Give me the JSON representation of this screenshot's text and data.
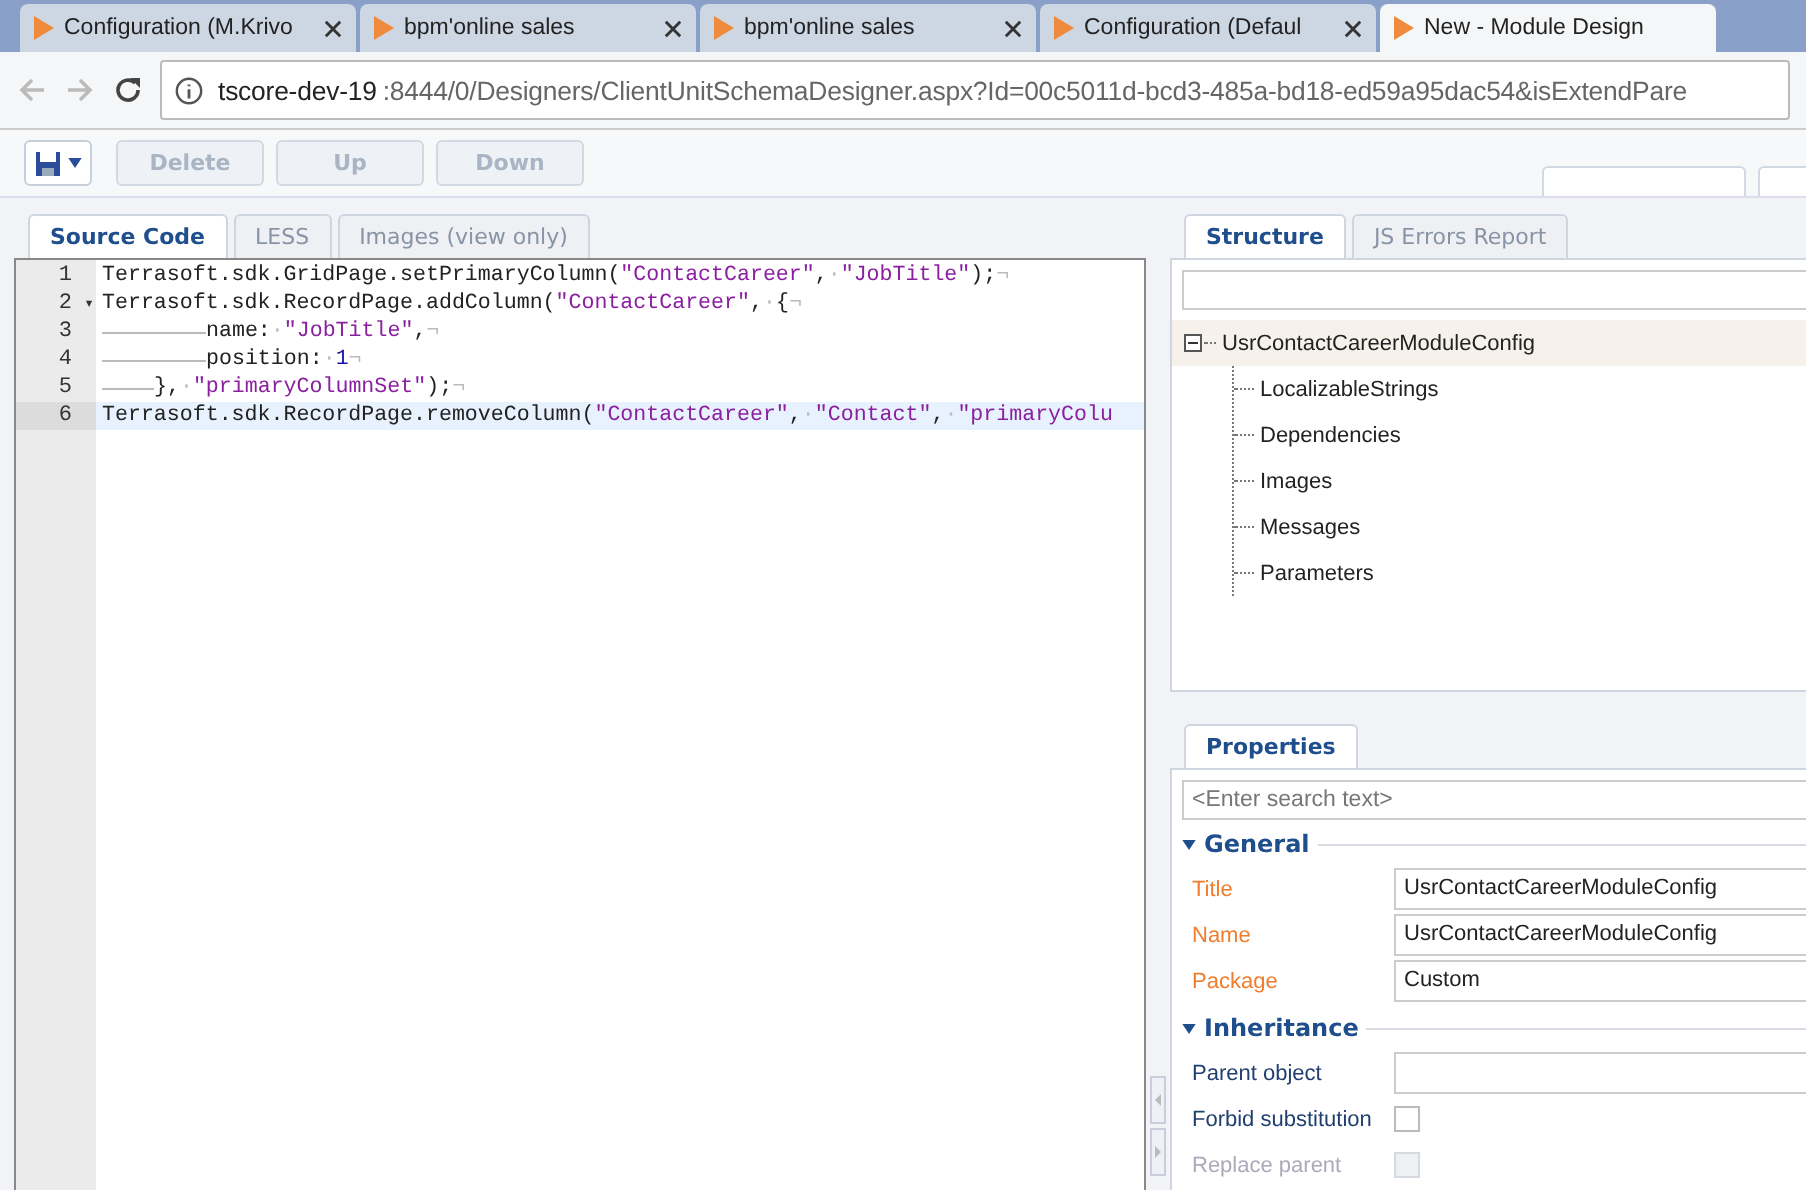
{
  "browser_tabs": [
    {
      "title": "Configuration (M.Krivo",
      "selected": false,
      "closable": true
    },
    {
      "title": "bpm'online sales",
      "selected": false,
      "closable": true
    },
    {
      "title": "bpm'online sales",
      "selected": false,
      "closable": true
    },
    {
      "title": "Configuration (Defaul",
      "selected": false,
      "closable": true
    },
    {
      "title": "New - Module Design",
      "selected": true,
      "closable": false
    }
  ],
  "address_bar": {
    "host": "tscore-dev-19",
    "path": ":8444/0/Designers/ClientUnitSchemaDesigner.aspx?Id=00c5011d-bcd3-485a-bd18-ed59a95dac54&isExtendPare"
  },
  "toolbar": {
    "buttons": [
      {
        "label": "Delete",
        "disabled": true
      },
      {
        "label": "Up",
        "disabled": true
      },
      {
        "label": "Down",
        "disabled": true
      }
    ]
  },
  "editor_tabs": [
    {
      "label": "Source Code",
      "selected": true
    },
    {
      "label": "LESS",
      "selected": false
    },
    {
      "label": "Images (view only)",
      "selected": false
    }
  ],
  "code_lines": [
    {
      "number": "1",
      "selected": false,
      "segments": [
        {
          "kind": "code",
          "text": "Terrasoft.sdk.GridPage.setPrimaryColumn("
        },
        {
          "kind": "string",
          "text": "\"ContactCareer\""
        },
        {
          "kind": "code",
          "text": ","
        },
        {
          "kind": "mark",
          "text": "·"
        },
        {
          "kind": "string",
          "text": "\"JobTitle\""
        },
        {
          "kind": "code",
          "text": ");"
        },
        {
          "kind": "mark",
          "text": "¬"
        }
      ]
    },
    {
      "number": "2",
      "fold": "▾",
      "selected": false,
      "segments": [
        {
          "kind": "code",
          "text": "Terrasoft.sdk.RecordPage.addColumn("
        },
        {
          "kind": "string",
          "text": "\"ContactCareer\""
        },
        {
          "kind": "code",
          "text": ","
        },
        {
          "kind": "mark",
          "text": "·"
        },
        {
          "kind": "code",
          "text": "{"
        },
        {
          "kind": "mark",
          "text": "¬"
        }
      ]
    },
    {
      "number": "3",
      "selected": false,
      "segments": [
        {
          "kind": "tab"
        },
        {
          "kind": "tab"
        },
        {
          "kind": "code",
          "text": "name:"
        },
        {
          "kind": "mark",
          "text": "·"
        },
        {
          "kind": "string",
          "text": "\"JobTitle\""
        },
        {
          "kind": "code",
          "text": ","
        },
        {
          "kind": "mark",
          "text": "¬"
        }
      ]
    },
    {
      "number": "4",
      "selected": false,
      "segments": [
        {
          "kind": "tab"
        },
        {
          "kind": "tab"
        },
        {
          "kind": "code",
          "text": "position:"
        },
        {
          "kind": "mark",
          "text": "·"
        },
        {
          "kind": "number",
          "text": "1"
        },
        {
          "kind": "mark",
          "text": "¬"
        }
      ]
    },
    {
      "number": "5",
      "selected": false,
      "segments": [
        {
          "kind": "tab"
        },
        {
          "kind": "code",
          "text": "},"
        },
        {
          "kind": "mark",
          "text": "·"
        },
        {
          "kind": "string",
          "text": "\"primaryColumnSet\""
        },
        {
          "kind": "code",
          "text": ");"
        },
        {
          "kind": "mark",
          "text": "¬"
        }
      ]
    },
    {
      "number": "6",
      "selected": true,
      "segments": [
        {
          "kind": "code",
          "text": "Terrasoft.sdk.RecordPage.removeColumn("
        },
        {
          "kind": "string",
          "text": "\"ContactCareer\""
        },
        {
          "kind": "code",
          "text": ","
        },
        {
          "kind": "mark",
          "text": "·"
        },
        {
          "kind": "string",
          "text": "\"Contact\""
        },
        {
          "kind": "code",
          "text": ","
        },
        {
          "kind": "mark",
          "text": "·"
        },
        {
          "kind": "string",
          "text": "\"primaryColu"
        }
      ]
    }
  ],
  "structure_tabs": [
    {
      "label": "Structure",
      "selected": true
    },
    {
      "label": "JS Errors Report",
      "selected": false
    }
  ],
  "structure_tree": {
    "label": "UsrContactCareerModuleConfig",
    "expanded": true,
    "children": [
      {
        "label": "LocalizableStrings"
      },
      {
        "label": "Dependencies"
      },
      {
        "label": "Images"
      },
      {
        "label": "Messages"
      },
      {
        "label": "Parameters"
      }
    ]
  },
  "properties_tabs": [
    {
      "label": "Properties",
      "selected": true
    }
  ],
  "properties_search": {
    "placeholder": "<Enter search text>"
  },
  "property_groups": [
    {
      "title": "General",
      "expanded": true,
      "rows": [
        {
          "kind": "text",
          "label": "Title",
          "value": "UsrContactCareerModuleConfig",
          "required": true,
          "disabled": false
        },
        {
          "kind": "text",
          "label": "Name",
          "value": "UsrContactCareerModuleConfig",
          "required": true,
          "disabled": false
        },
        {
          "kind": "text",
          "label": "Package",
          "value": "Custom",
          "required": true,
          "disabled": false
        }
      ]
    },
    {
      "title": "Inheritance",
      "expanded": true,
      "rows": [
        {
          "kind": "text",
          "label": "Parent object",
          "required": false,
          "disabled": false
        },
        {
          "kind": "checkbox",
          "label": "Forbid substitution",
          "checked": false,
          "required": false,
          "disabled": false
        },
        {
          "kind": "checkbox",
          "label": "Replace parent",
          "checked": false,
          "required": false,
          "disabled": true
        }
      ]
    }
  ]
}
